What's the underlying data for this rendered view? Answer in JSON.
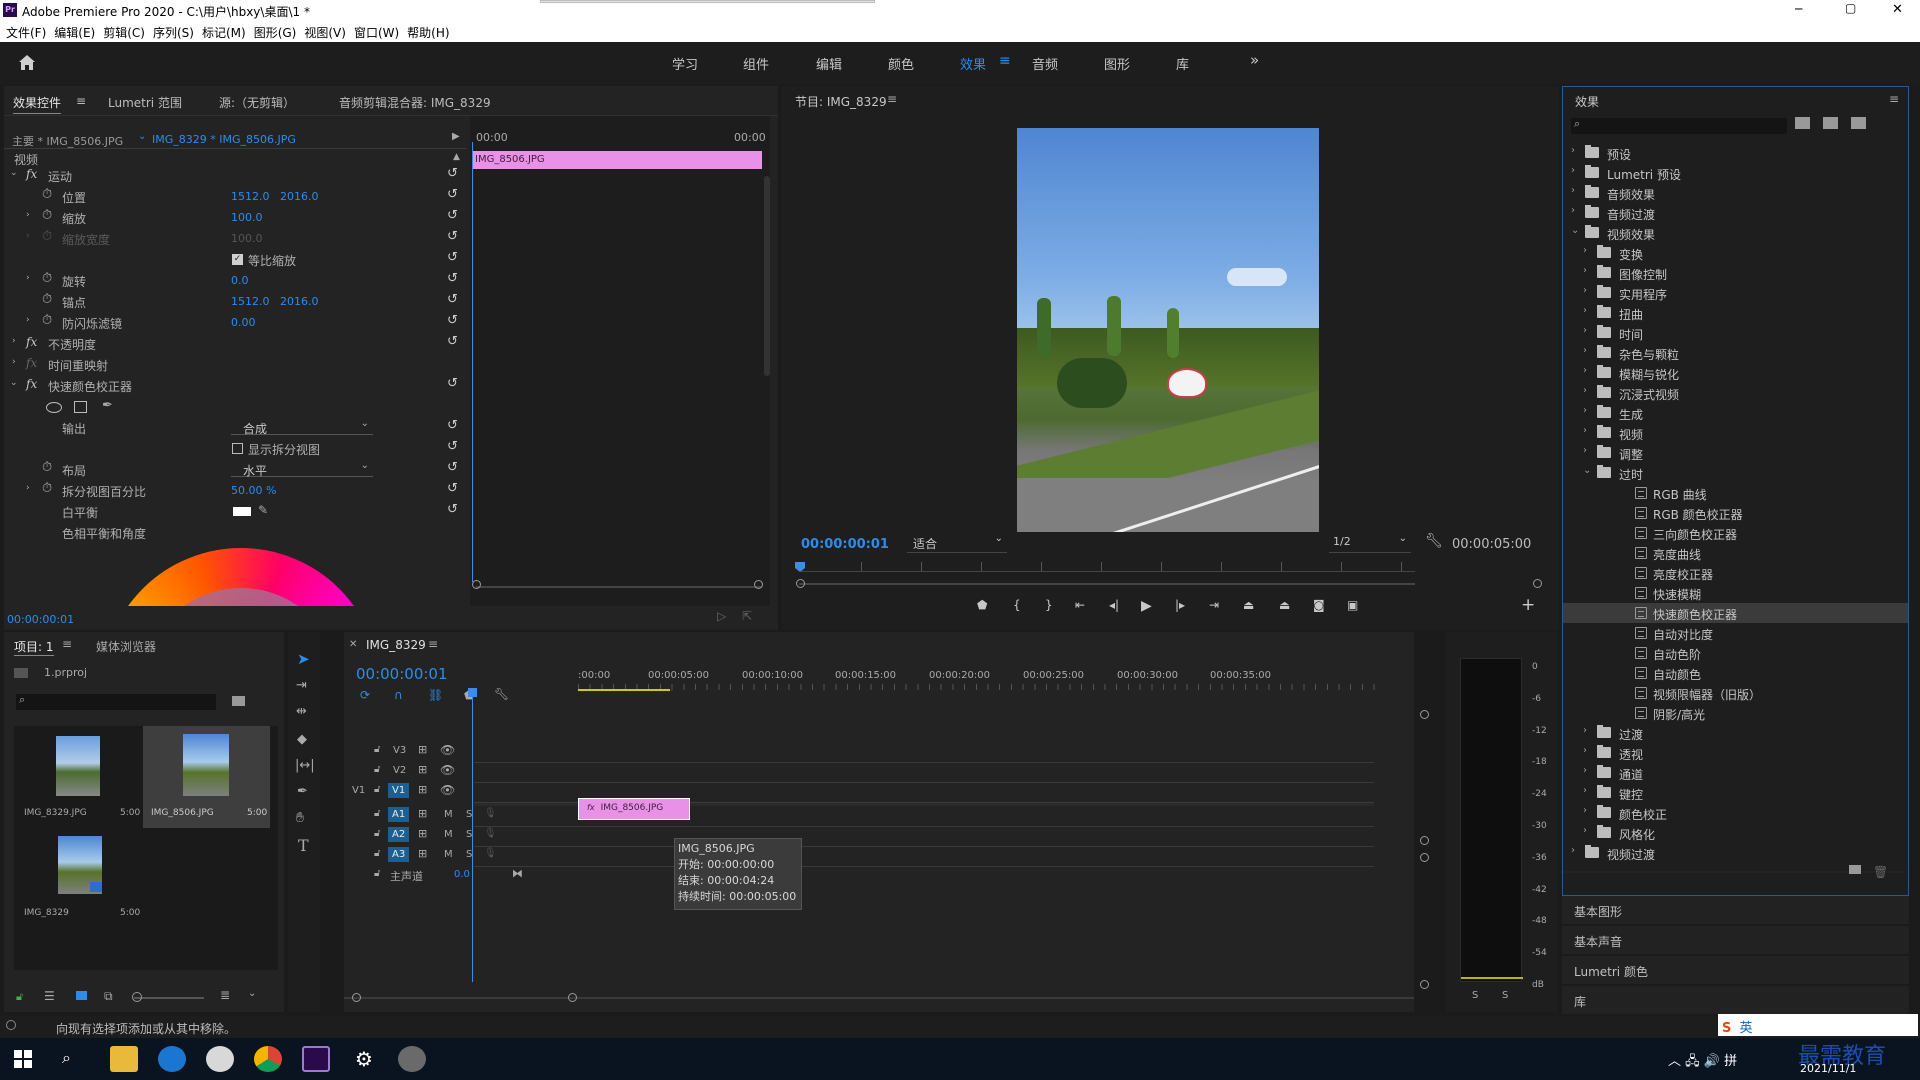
{
  "app": {
    "title": "Adobe Premiere Pro 2020 - C:\\用户\\hbxy\\桌面\\1 *",
    "logo": "Pr",
    "minimize": "─",
    "maximize": "▢",
    "close": "✕"
  },
  "menu": [
    "文件(F)",
    "编辑(E)",
    "剪辑(C)",
    "序列(S)",
    "标记(M)",
    "图形(G)",
    "视图(V)",
    "窗口(W)",
    "帮助(H)"
  ],
  "workspaces": {
    "home_icon": "home-icon",
    "tabs": [
      "学习",
      "组件",
      "编辑",
      "颜色",
      "效果",
      "音频",
      "图形",
      "库"
    ],
    "active": "效果",
    "more": "»"
  },
  "effect_controls": {
    "tabs": [
      "效果控件",
      "Lumetri 范围",
      "源:（无剪辑）",
      "音频剪辑混合器: IMG_8329"
    ],
    "master": "主要 * IMG_8506.JPG",
    "sequence_clip": "IMG_8329 * IMG_8506.JPG",
    "mini_timeline": {
      "start": "00:00",
      "end": "00:00",
      "clip": "IMG_8506.JPG"
    },
    "section_video": "视频",
    "rows": [
      {
        "name": "运动",
        "fx": true,
        "indent": 1,
        "open": true
      },
      {
        "name": "位置",
        "v1": "1512.0",
        "v2": "2016.0",
        "stopwatch": true
      },
      {
        "name": "缩放",
        "v1": "100.0",
        "stopwatch": true,
        "caret": true
      },
      {
        "name": "缩放宽度",
        "v1": "100.0",
        "dim": true,
        "caret": true
      },
      {
        "checkbox": "等比缩放",
        "checked": true
      },
      {
        "name": "旋转",
        "v1": "0.0",
        "stopwatch": true,
        "caret": true
      },
      {
        "name": "锚点",
        "v1": "1512.0",
        "v2": "2016.0",
        "stopwatch": true
      },
      {
        "name": "防闪烁滤镜",
        "v1": "0.00",
        "stopwatch": true,
        "caret": true
      },
      {
        "name": "不透明度",
        "fx": true,
        "indent": 1
      },
      {
        "name": "时间重映射",
        "fx": false,
        "indent": 1
      },
      {
        "name": "快速颜色校正器",
        "fx": true,
        "indent": 1,
        "open": true
      },
      {
        "masks": true
      },
      {
        "name": "输出",
        "select": "合成"
      },
      {
        "checkbox": "显示拆分视图",
        "checked": false
      },
      {
        "name": "布局",
        "select": "水平",
        "stopwatch": true
      },
      {
        "name": "拆分视图百分比",
        "v1": "50.00 %",
        "stopwatch": true,
        "caret": true
      },
      {
        "name": "白平衡",
        "swatch": "#ffffff"
      },
      {
        "name": "色相平衡和角度"
      }
    ],
    "timecode": "00:00:00:01"
  },
  "program": {
    "title": "节目: IMG_8329",
    "timecode": "00:00:00:01",
    "fit": "适合",
    "quality": "1/2",
    "duration": "00:00:05:00",
    "controls": [
      "marker-icon",
      "in-point-icon",
      "out-point-icon",
      "go-to-in-icon",
      "step-back-icon",
      "play-icon",
      "step-forward-icon",
      "go-to-out-icon",
      "lift-icon",
      "extract-icon",
      "export-frame-icon",
      "compare-icon"
    ]
  },
  "effects": {
    "title": "效果",
    "items": [
      {
        "label": "预设",
        "level": 0,
        "kind": "folder-star"
      },
      {
        "label": "Lumetri 预设",
        "level": 0,
        "kind": "folder-star"
      },
      {
        "label": "音频效果",
        "level": 0,
        "kind": "folder"
      },
      {
        "label": "音频过渡",
        "level": 0,
        "kind": "folder"
      },
      {
        "label": "视频效果",
        "level": 0,
        "kind": "folder",
        "open": true
      },
      {
        "label": "变换",
        "level": 1,
        "kind": "folder"
      },
      {
        "label": "图像控制",
        "level": 1,
        "kind": "folder"
      },
      {
        "label": "实用程序",
        "level": 1,
        "kind": "folder"
      },
      {
        "label": "扭曲",
        "level": 1,
        "kind": "folder"
      },
      {
        "label": "时间",
        "level": 1,
        "kind": "folder"
      },
      {
        "label": "杂色与颗粒",
        "level": 1,
        "kind": "folder"
      },
      {
        "label": "模糊与锐化",
        "level": 1,
        "kind": "folder"
      },
      {
        "label": "沉浸式视频",
        "level": 1,
        "kind": "folder"
      },
      {
        "label": "生成",
        "level": 1,
        "kind": "folder"
      },
      {
        "label": "视频",
        "level": 1,
        "kind": "folder"
      },
      {
        "label": "调整",
        "level": 1,
        "kind": "folder"
      },
      {
        "label": "过时",
        "level": 1,
        "kind": "folder",
        "open": true
      },
      {
        "label": "RGB 曲线",
        "level": 2,
        "kind": "fx"
      },
      {
        "label": "RGB 颜色校正器",
        "level": 2,
        "kind": "fx"
      },
      {
        "label": "三向颜色校正器",
        "level": 2,
        "kind": "fx"
      },
      {
        "label": "亮度曲线",
        "level": 2,
        "kind": "fx"
      },
      {
        "label": "亮度校正器",
        "level": 2,
        "kind": "fx"
      },
      {
        "label": "快速模糊",
        "level": 2,
        "kind": "fx"
      },
      {
        "label": "快速颜色校正器",
        "level": 2,
        "kind": "fx",
        "selected": true
      },
      {
        "label": "自动对比度",
        "level": 2,
        "kind": "fx"
      },
      {
        "label": "自动色阶",
        "level": 2,
        "kind": "fx"
      },
      {
        "label": "自动颜色",
        "level": 2,
        "kind": "fx"
      },
      {
        "label": "视频限幅器（旧版）",
        "level": 2,
        "kind": "fx"
      },
      {
        "label": "阴影/高光",
        "level": 2,
        "kind": "fx"
      },
      {
        "label": "过渡",
        "level": 1,
        "kind": "folder"
      },
      {
        "label": "透视",
        "level": 1,
        "kind": "folder"
      },
      {
        "label": "通道",
        "level": 1,
        "kind": "folder"
      },
      {
        "label": "键控",
        "level": 1,
        "kind": "folder"
      },
      {
        "label": "颜色校正",
        "level": 1,
        "kind": "folder"
      },
      {
        "label": "风格化",
        "level": 1,
        "kind": "folder"
      },
      {
        "label": "视频过渡",
        "level": 0,
        "kind": "folder"
      }
    ],
    "collapsed_panels": [
      "基本图形",
      "基本声音",
      "Lumetri 颜色",
      "库"
    ]
  },
  "project": {
    "tabs": [
      "项目: 1",
      "媒体浏览器"
    ],
    "file": "1.prproj",
    "items": [
      {
        "name": "IMG_8329.JPG",
        "duration": "5:00"
      },
      {
        "name": "IMG_8506.JPG",
        "duration": "5:00",
        "selected": true
      },
      {
        "name": "IMG_8329",
        "duration": "5:00"
      }
    ]
  },
  "timeline": {
    "tab": "IMG_8329",
    "timecode": "00:00:00:01",
    "ruler": [
      ":00:00",
      "00:00:05:00",
      "00:00:10:00",
      "00:00:15:00",
      "00:00:20:00",
      "00:00:25:00",
      "00:00:30:00",
      "00:00:35:00"
    ],
    "video_tracks": [
      "V3",
      "V2",
      "V1"
    ],
    "audio_tracks": [
      "A1",
      "A2",
      "A3"
    ],
    "source_patch": "V1",
    "master": "主声道",
    "master_val": "0.0",
    "clip": "IMG_8506.JPG",
    "tooltip": [
      "IMG_8506.JPG",
      "开始: 00:00:00:00",
      "结束: 00:00:04:24",
      "持续时间: 00:00:05:00"
    ]
  },
  "meter": {
    "scale": [
      "0",
      "-6",
      "-12",
      "-18",
      "-24",
      "-30",
      "-36",
      "-42",
      "-48",
      "-54",
      "dB"
    ],
    "solo": [
      "S",
      "S"
    ]
  },
  "status": "向现有选择项添加或从其中移除。",
  "taskbar": {
    "clock_date": "2021/11/1",
    "ime": "英",
    "watermark": "最需教育"
  },
  "colors": {
    "accent": "#2d8ceb",
    "clip": "#e991e6",
    "sky": "#5a8fd4"
  }
}
